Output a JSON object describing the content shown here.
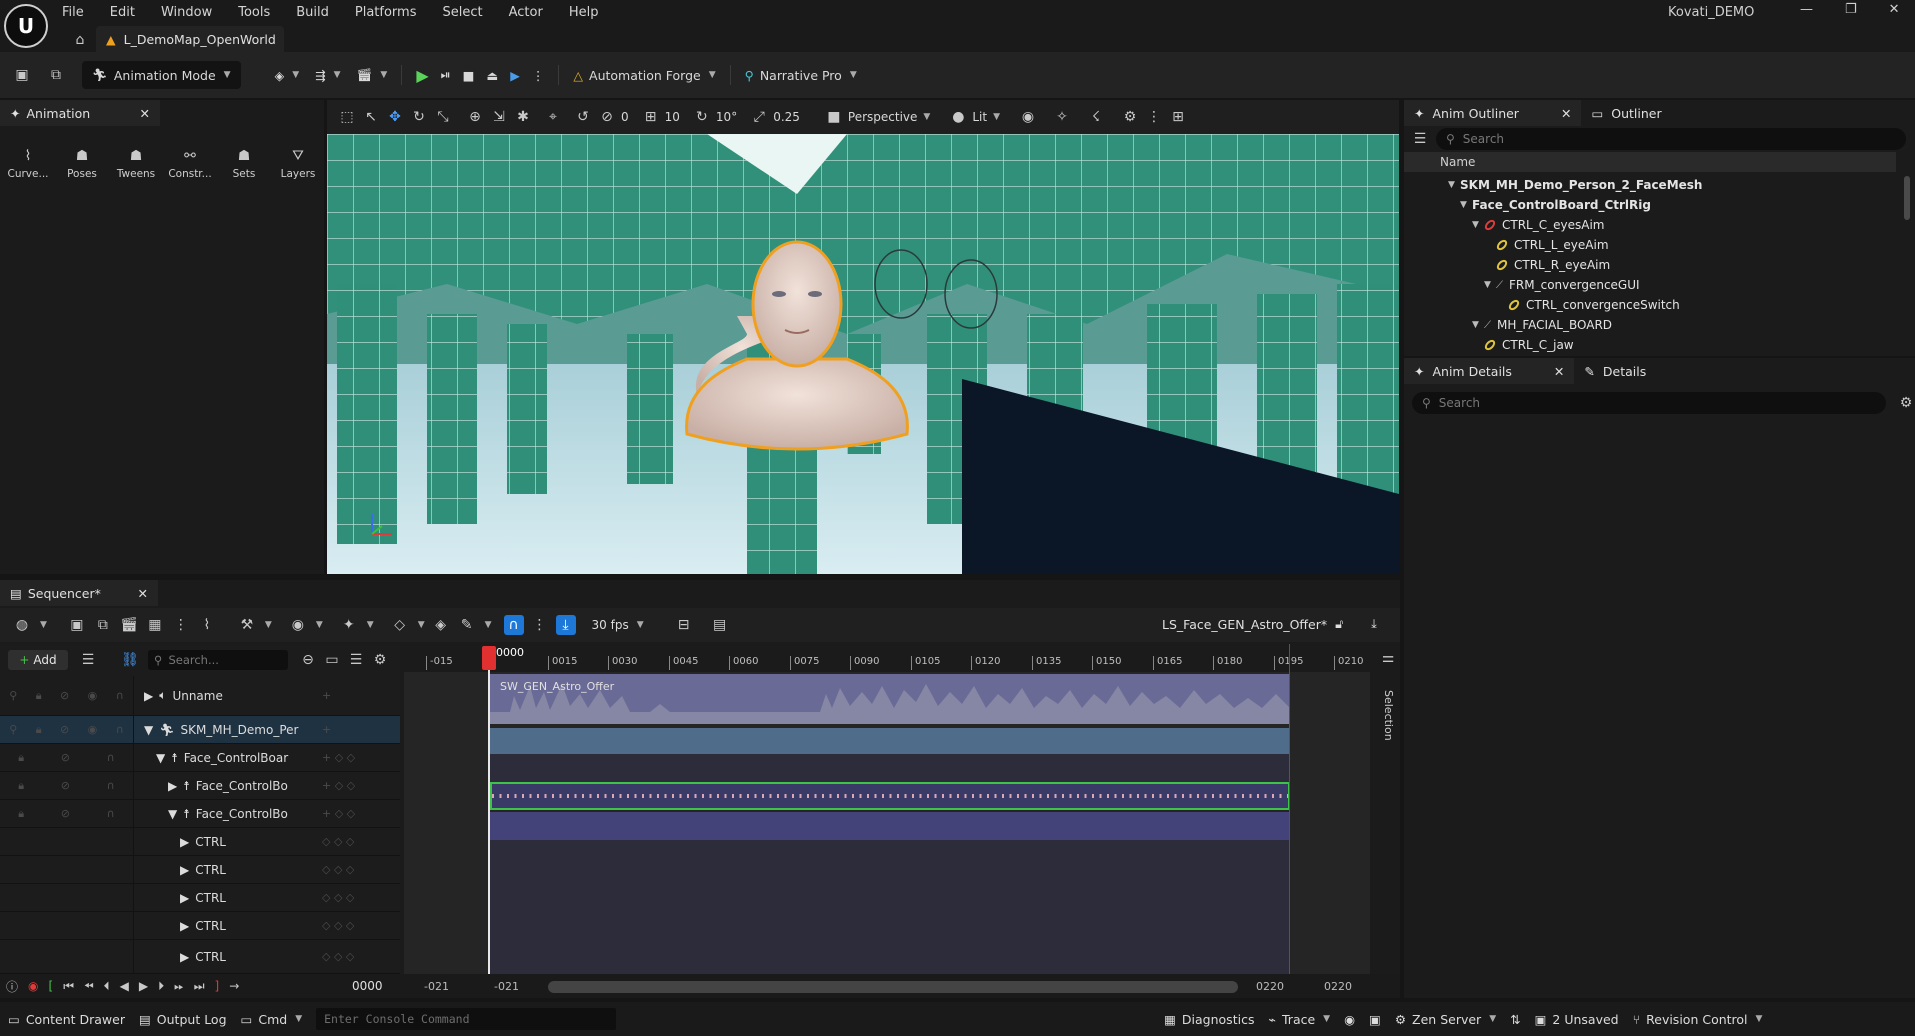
{
  "titlebar": {
    "menu": [
      "File",
      "Edit",
      "Window",
      "Tools",
      "Build",
      "Platforms",
      "Select",
      "Actor",
      "Help"
    ],
    "project_name": "Kovati_DEMO",
    "level_tab": "L_DemoMap_OpenWorld"
  },
  "toolbar": {
    "mode": "Animation Mode",
    "automation": "Automation Forge",
    "narrative": "Narrative Pro"
  },
  "animation_panel": {
    "tab": "Animation",
    "tools": [
      "Curve...",
      "Poses",
      "Tweens",
      "Constr...",
      "Sets",
      "Layers"
    ]
  },
  "viewport": {
    "rot_snap": "0",
    "grid_snap": "10",
    "angle_snap": "10°",
    "scale_snap": "0.25",
    "view_mode": "Perspective",
    "lighting": "Lit"
  },
  "outliner": {
    "tabs": [
      "Anim Outliner",
      "Outliner"
    ],
    "search_placeholder": "Search",
    "column": "Name",
    "items": [
      "SKM_MH_Demo_Person_2_FaceMesh",
      "Face_ControlBoard_CtrlRig",
      "CTRL_C_eyesAim",
      "CTRL_L_eyeAim",
      "CTRL_R_eyeAim",
      "FRM_convergenceGUI",
      "CTRL_convergenceSwitch",
      "MH_FACIAL_BOARD",
      "CTRL_C_jaw"
    ]
  },
  "details": {
    "tabs": [
      "Anim Details",
      "Details"
    ],
    "search_placeholder": "Search"
  },
  "sequencer": {
    "tab": "Sequencer*",
    "add": "Add",
    "search_placeholder": "Search...",
    "fps": "30 fps",
    "sequence_name": "LS_Face_GEN_Astro_Offer*",
    "tracks": [
      "Unnamе",
      "SKM_MH_Demo_Per",
      "Face_ControlBoar",
      "Face_ControlBo",
      "Face_ControlBo",
      "CTRL",
      "CTRL",
      "CTRL",
      "CTRL",
      "CTRL"
    ],
    "audio_clip": "SW_GEN_Astro_Offer",
    "playhead": "0000",
    "ticks": [
      "-015",
      "0015",
      "0030",
      "0045",
      "0060",
      "0075",
      "0090",
      "0105",
      "0120",
      "0135",
      "0150",
      "0165",
      "0180",
      "0195",
      "0210"
    ],
    "current_frame": "0000",
    "range_start": "-021",
    "range_in": "-021",
    "range_out": "0220",
    "range_end": "0220",
    "selection_label": "Selection"
  },
  "statusbar": {
    "content_drawer": "Content Drawer",
    "output_log": "Output Log",
    "cmd": "Cmd",
    "console_placeholder": "Enter Console Command",
    "diagnostics": "Diagnostics",
    "trace": "Trace",
    "zen": "Zen Server",
    "unsaved": "2 Unsaved",
    "revision": "Revision Control"
  },
  "colors": {
    "accent_blue": "#1e78d8",
    "play_green": "#5bd35b",
    "selection_orange": "#f0a020"
  }
}
